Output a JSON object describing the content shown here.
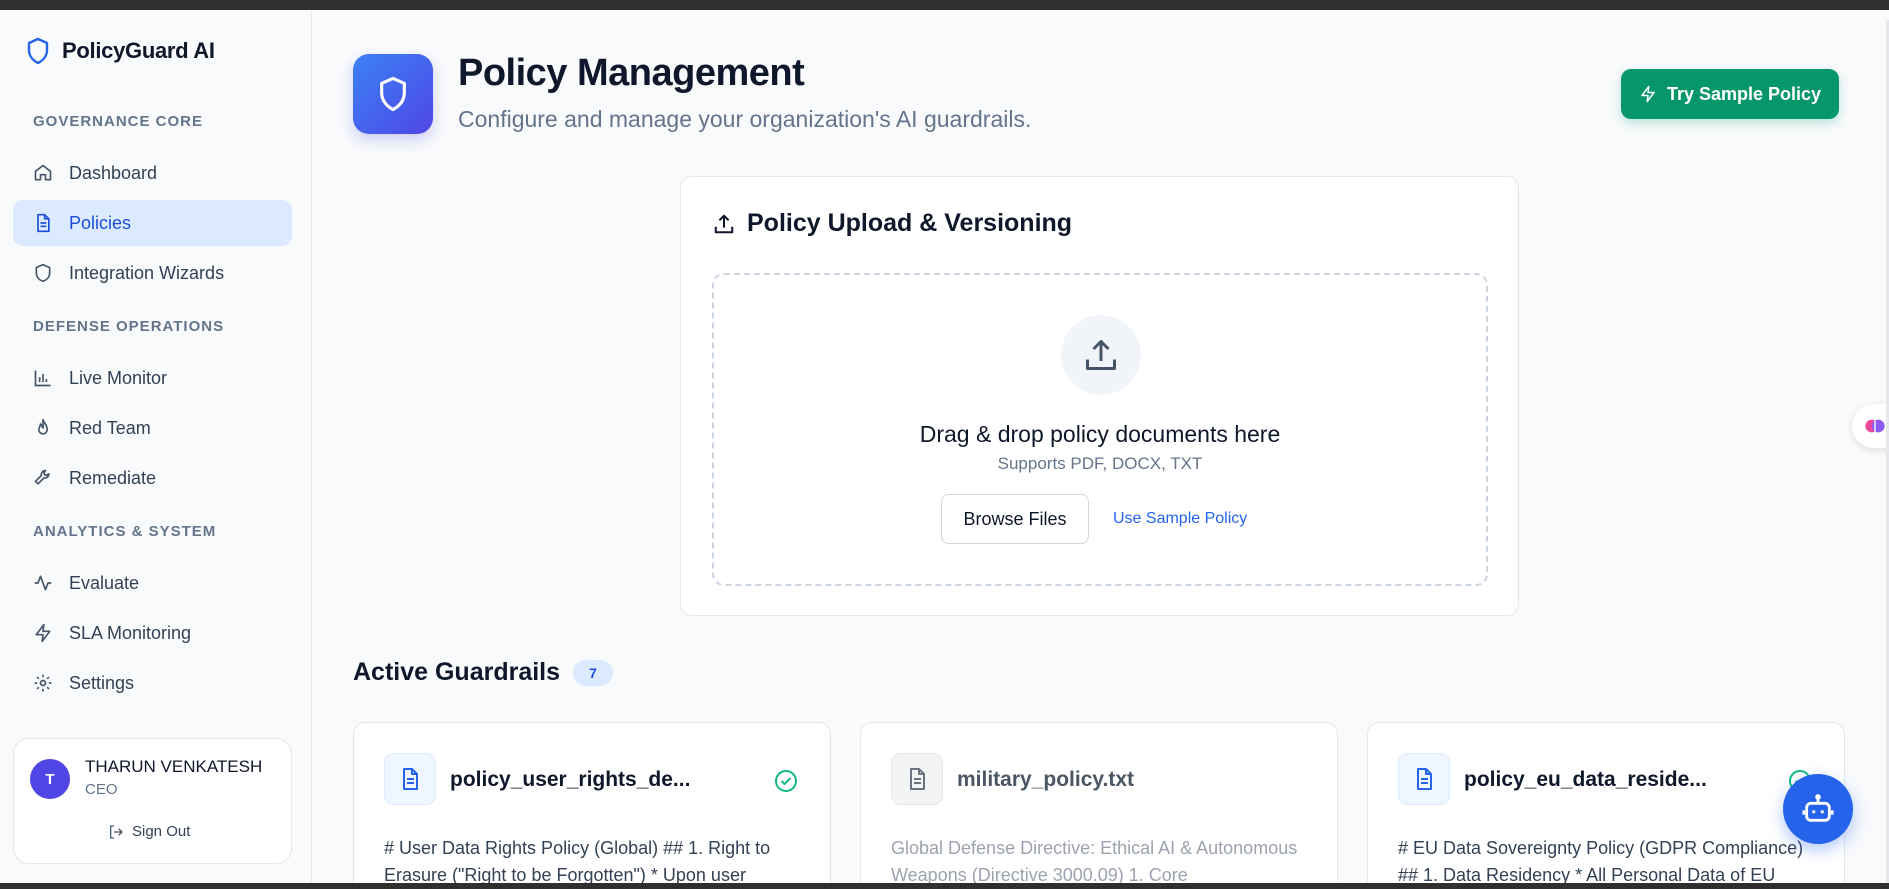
{
  "brand": {
    "name": "PolicyGuard AI"
  },
  "sidebar": {
    "sections": [
      {
        "label": "GOVERNANCE CORE"
      },
      {
        "label": "DEFENSE OPERATIONS"
      },
      {
        "label": "ANALYTICS & SYSTEM"
      }
    ],
    "items": [
      {
        "label": "Dashboard",
        "icon": "home-icon"
      },
      {
        "label": "Policies",
        "icon": "document-icon",
        "active": true
      },
      {
        "label": "Integration Wizards",
        "icon": "shield-icon"
      },
      {
        "label": "Live Monitor",
        "icon": "bar-chart-icon"
      },
      {
        "label": "Red Team",
        "icon": "flame-icon"
      },
      {
        "label": "Remediate",
        "icon": "wrench-icon"
      },
      {
        "label": "Evaluate",
        "icon": "activity-icon"
      },
      {
        "label": "SLA Monitoring",
        "icon": "lightning-icon"
      },
      {
        "label": "Settings",
        "icon": "gear-icon"
      }
    ]
  },
  "user": {
    "initial": "T",
    "name": "THARUN VENKATESH",
    "role": "CEO",
    "signout_label": "Sign Out"
  },
  "header": {
    "title": "Policy Management",
    "subtitle": "Configure and manage your organization's AI guardrails.",
    "try_button": "Try Sample Policy"
  },
  "upload": {
    "title": "Policy Upload & Versioning",
    "drop_title": "Drag & drop policy documents here",
    "drop_sub": "Supports PDF, DOCX, TXT",
    "browse_label": "Browse Files",
    "sample_link": "Use Sample Policy"
  },
  "guardrails": {
    "title": "Active Guardrails",
    "count": "7",
    "cards": [
      {
        "filename": "policy_user_rights_de...",
        "status": "active",
        "preview": "# User Data Rights Policy (Global) ## 1. Right to Erasure (\"Right to be Forgotten\") * Upon user"
      },
      {
        "filename": "military_policy.txt",
        "status": "inactive",
        "preview": "Global Defense Directive: Ethical AI & Autonomous Weapons (Directive 3000.09) 1. Core"
      },
      {
        "filename": "policy_eu_data_reside...",
        "status": "active",
        "preview": "# EU Data Sovereignty Policy (GDPR Compliance) ## 1. Data Residency * All Personal Data of EU"
      }
    ]
  },
  "colors": {
    "accent": "#2563eb",
    "success": "#059669",
    "active_bg": "#dbeafe"
  }
}
